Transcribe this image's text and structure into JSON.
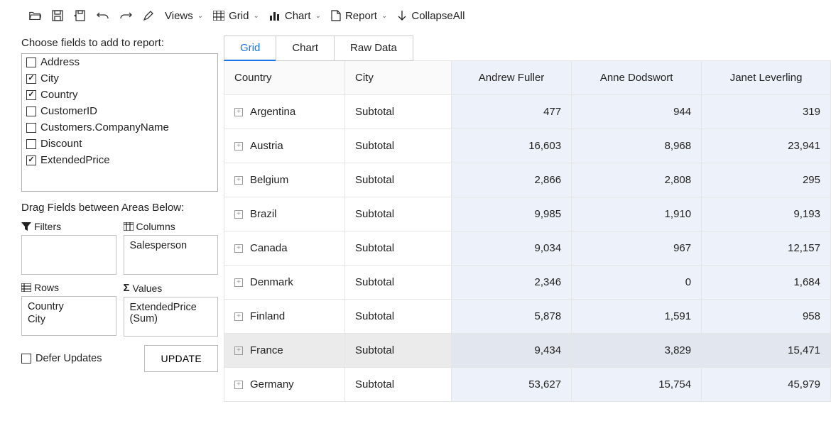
{
  "toolbar": {
    "views_label": "Views",
    "grid_label": "Grid",
    "chart_label": "Chart",
    "report_label": "Report",
    "collapse_label": "CollapseAll"
  },
  "sidebar": {
    "chooser_title": "Choose fields to add to report:",
    "fields": [
      {
        "name": "Address",
        "checked": false
      },
      {
        "name": "City",
        "checked": true
      },
      {
        "name": "Country",
        "checked": true
      },
      {
        "name": "CustomerID",
        "checked": false
      },
      {
        "name": "Customers.CompanyName",
        "checked": false
      },
      {
        "name": "Discount",
        "checked": false
      },
      {
        "name": "ExtendedPrice",
        "checked": true
      }
    ],
    "areas_title": "Drag Fields between Areas Below:",
    "filters_label": "Filters",
    "columns_label": "Columns",
    "rows_label": "Rows",
    "values_label": "Values",
    "columns_items": [
      "Salesperson"
    ],
    "rows_items": [
      "Country",
      "City"
    ],
    "values_items": [
      "ExtendedPrice (Sum)"
    ],
    "defer_label": "Defer Updates",
    "update_label": "UPDATE"
  },
  "tabs": {
    "grid": "Grid",
    "chart": "Chart",
    "rawdata": "Raw Data"
  },
  "grid": {
    "headers": {
      "country": "Country",
      "city": "City",
      "col1": "Andrew Fuller",
      "col2": "Anne Dodswort",
      "col3": "Janet Leverling"
    },
    "rows": [
      {
        "country": "Argentina",
        "city": "Subtotal",
        "v1": "477",
        "v2": "944",
        "v3": "319"
      },
      {
        "country": "Austria",
        "city": "Subtotal",
        "v1": "16,603",
        "v2": "8,968",
        "v3": "23,941"
      },
      {
        "country": "Belgium",
        "city": "Subtotal",
        "v1": "2,866",
        "v2": "2,808",
        "v3": "295"
      },
      {
        "country": "Brazil",
        "city": "Subtotal",
        "v1": "9,985",
        "v2": "1,910",
        "v3": "9,193"
      },
      {
        "country": "Canada",
        "city": "Subtotal",
        "v1": "9,034",
        "v2": "967",
        "v3": "12,157"
      },
      {
        "country": "Denmark",
        "city": "Subtotal",
        "v1": "2,346",
        "v2": "0",
        "v3": "1,684"
      },
      {
        "country": "Finland",
        "city": "Subtotal",
        "v1": "5,878",
        "v2": "1,591",
        "v3": "958"
      },
      {
        "country": "France",
        "city": "Subtotal",
        "v1": "9,434",
        "v2": "3,829",
        "v3": "15,471",
        "hover": true
      },
      {
        "country": "Germany",
        "city": "Subtotal",
        "v1": "53,627",
        "v2": "15,754",
        "v3": "45,979"
      }
    ]
  }
}
